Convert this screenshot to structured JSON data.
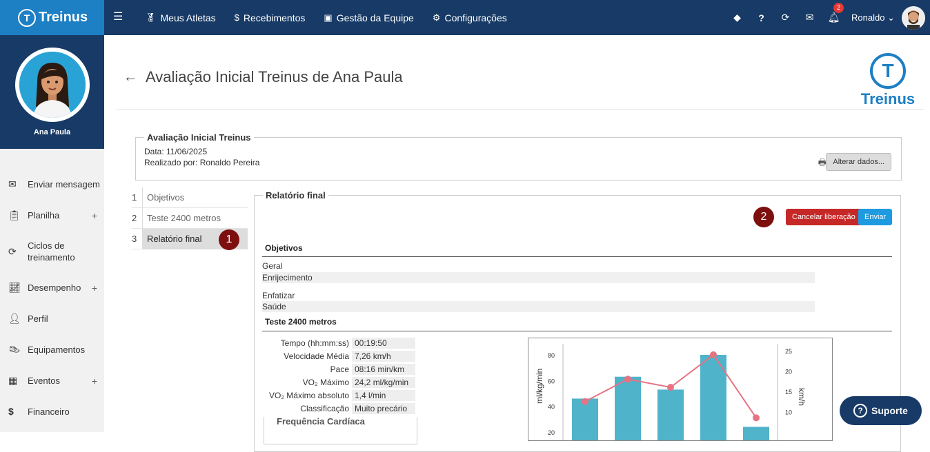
{
  "brand": {
    "name": "Treinus"
  },
  "nav": [
    {
      "icon": "medal-icon",
      "label": "Meus Atletas"
    },
    {
      "icon": "dollar-icon",
      "label": "Recebimentos"
    },
    {
      "icon": "id-card-icon",
      "label": "Gestão da Equipe"
    },
    {
      "icon": "gears-icon",
      "label": "Configurações"
    }
  ],
  "topbar": {
    "notifications_count": "2",
    "user_name": "Ronaldo"
  },
  "sidebar": {
    "profile_name": "Ana Paula",
    "items": [
      {
        "label": "Enviar mensagem"
      },
      {
        "label": "Planilha"
      },
      {
        "label": "Ciclos de treinamento"
      },
      {
        "label": "Desempenho"
      },
      {
        "label": "Perfil"
      },
      {
        "label": "Equipamentos"
      },
      {
        "label": "Eventos"
      },
      {
        "label": "Financeiro"
      }
    ]
  },
  "page": {
    "title": "Avaliação Inicial Treinus de Ana Paula"
  },
  "evaluation": {
    "legend": "Avaliação Inicial Treinus",
    "date": "Data: 11/06/2025",
    "author": "Realizado por: Ronaldo Pereira",
    "edit_button": "Alterar dados..."
  },
  "steps": [
    {
      "num": "1",
      "label": "Objetivos"
    },
    {
      "num": "2",
      "label": "Teste 2400 metros"
    },
    {
      "num": "3",
      "label": "Relatório final"
    }
  ],
  "markers": {
    "m1": "1",
    "m2": "2"
  },
  "report": {
    "legend": "Relatório final",
    "cancel_button": "Cancelar liberação",
    "send_button": "Enviar",
    "objectives_title": "Objetivos",
    "general_label": "Geral",
    "general_value": "Enrijecimento",
    "emphasis_label": "Enfatizar",
    "emphasis_value": "Saúde",
    "test_title": "Teste 2400 metros",
    "metrics": [
      {
        "key": "Tempo (hh:mm:ss)",
        "value": "00:19:50"
      },
      {
        "key": "Velocidade Média",
        "value": "7,26 km/h"
      },
      {
        "key": "Pace",
        "value": "08:16 min/km"
      },
      {
        "key": "VO₂ Máximo",
        "value": "24,2 ml/kg/min"
      },
      {
        "key": "VO₂ Máximo absoluto",
        "value": "1,4 l/min"
      },
      {
        "key": "Classificação",
        "value": "Muito precário"
      }
    ],
    "heart_rate_legend": "Frequência Cardíaca"
  },
  "chart_data": {
    "type": "bar",
    "ylabel": "ml/kg/min",
    "y2label": "km/h",
    "yticks": [
      "80",
      "60",
      "40",
      "20"
    ],
    "y2ticks": [
      "25",
      "20",
      "15",
      "10"
    ],
    "bar_values": [
      46,
      63,
      53,
      80,
      24
    ],
    "line_values": [
      12.5,
      18,
      16,
      24,
      8.5
    ],
    "colors": {
      "bar": "#4fb3c9",
      "line": "#e57383"
    }
  },
  "support": {
    "label": "Suporte"
  }
}
